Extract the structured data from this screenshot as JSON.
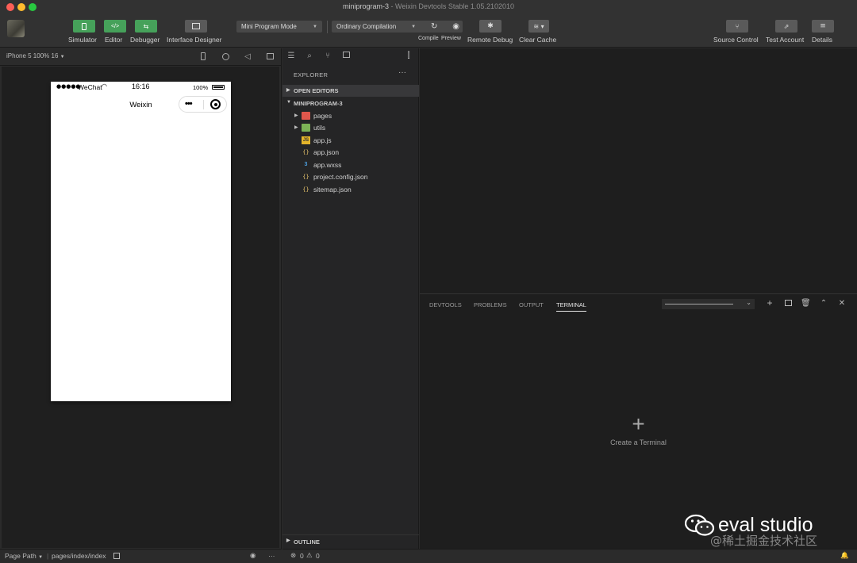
{
  "window": {
    "project_name": "miniprogram-3",
    "app_title": "Weixin Devtools Stable 1.05.2102010"
  },
  "toolbar": {
    "simulator": "Simulator",
    "editor": "Editor",
    "debugger": "Debugger",
    "interface_designer": "Interface Designer",
    "mode": "Mini Program Mode",
    "compilation": "Ordinary Compilation",
    "compile": "Compile",
    "preview": "Preview",
    "remote_debug": "Remote Debug",
    "clear_cache": "Clear Cache",
    "source_control": "Source Control",
    "test_account": "Test Account",
    "details": "Details",
    "simulator_icon": "</>",
    "debugger_icon": "⇆"
  },
  "simulator": {
    "device": "iPhone 5 100% 16",
    "status": {
      "signal": "●●●●●",
      "carrier": "WeChat",
      "time": "16:16",
      "battery": "100%"
    },
    "nav_title": "Weixin",
    "capsule_dots": "•••"
  },
  "sim_footer": {
    "page_path_label": "Page Path",
    "page_path": "pages/index/index",
    "more": "···"
  },
  "explorer": {
    "title": "EXPLORER",
    "more": "···",
    "open_editors": "OPEN EDITORS",
    "project": "MINIPROGRAM-3",
    "items": [
      {
        "name": "pages",
        "type": "folder"
      },
      {
        "name": "utils",
        "type": "folder"
      },
      {
        "name": "app.js",
        "type": "js"
      },
      {
        "name": "app.json",
        "type": "json"
      },
      {
        "name": "app.wxss",
        "type": "css"
      },
      {
        "name": "project.config.json",
        "type": "json"
      },
      {
        "name": "sitemap.json",
        "type": "json"
      }
    ],
    "outline": "OUTLINE"
  },
  "panel": {
    "tabs": [
      "DEVTOOLS",
      "PROBLEMS",
      "OUTPUT",
      "TERMINAL"
    ],
    "active_tab": "TERMINAL",
    "create_terminal": "Create a Terminal",
    "plus": "+"
  },
  "status_bar": {
    "errors": "0",
    "warnings": "0"
  },
  "watermark": {
    "brand": "eval studio",
    "sub": "@稀土掘金技术社区"
  },
  "colors": {
    "green_button": "#46a15a",
    "gray_button": "#5a5a5a",
    "background": "#1e1e1e",
    "toolbar": "#323232"
  }
}
